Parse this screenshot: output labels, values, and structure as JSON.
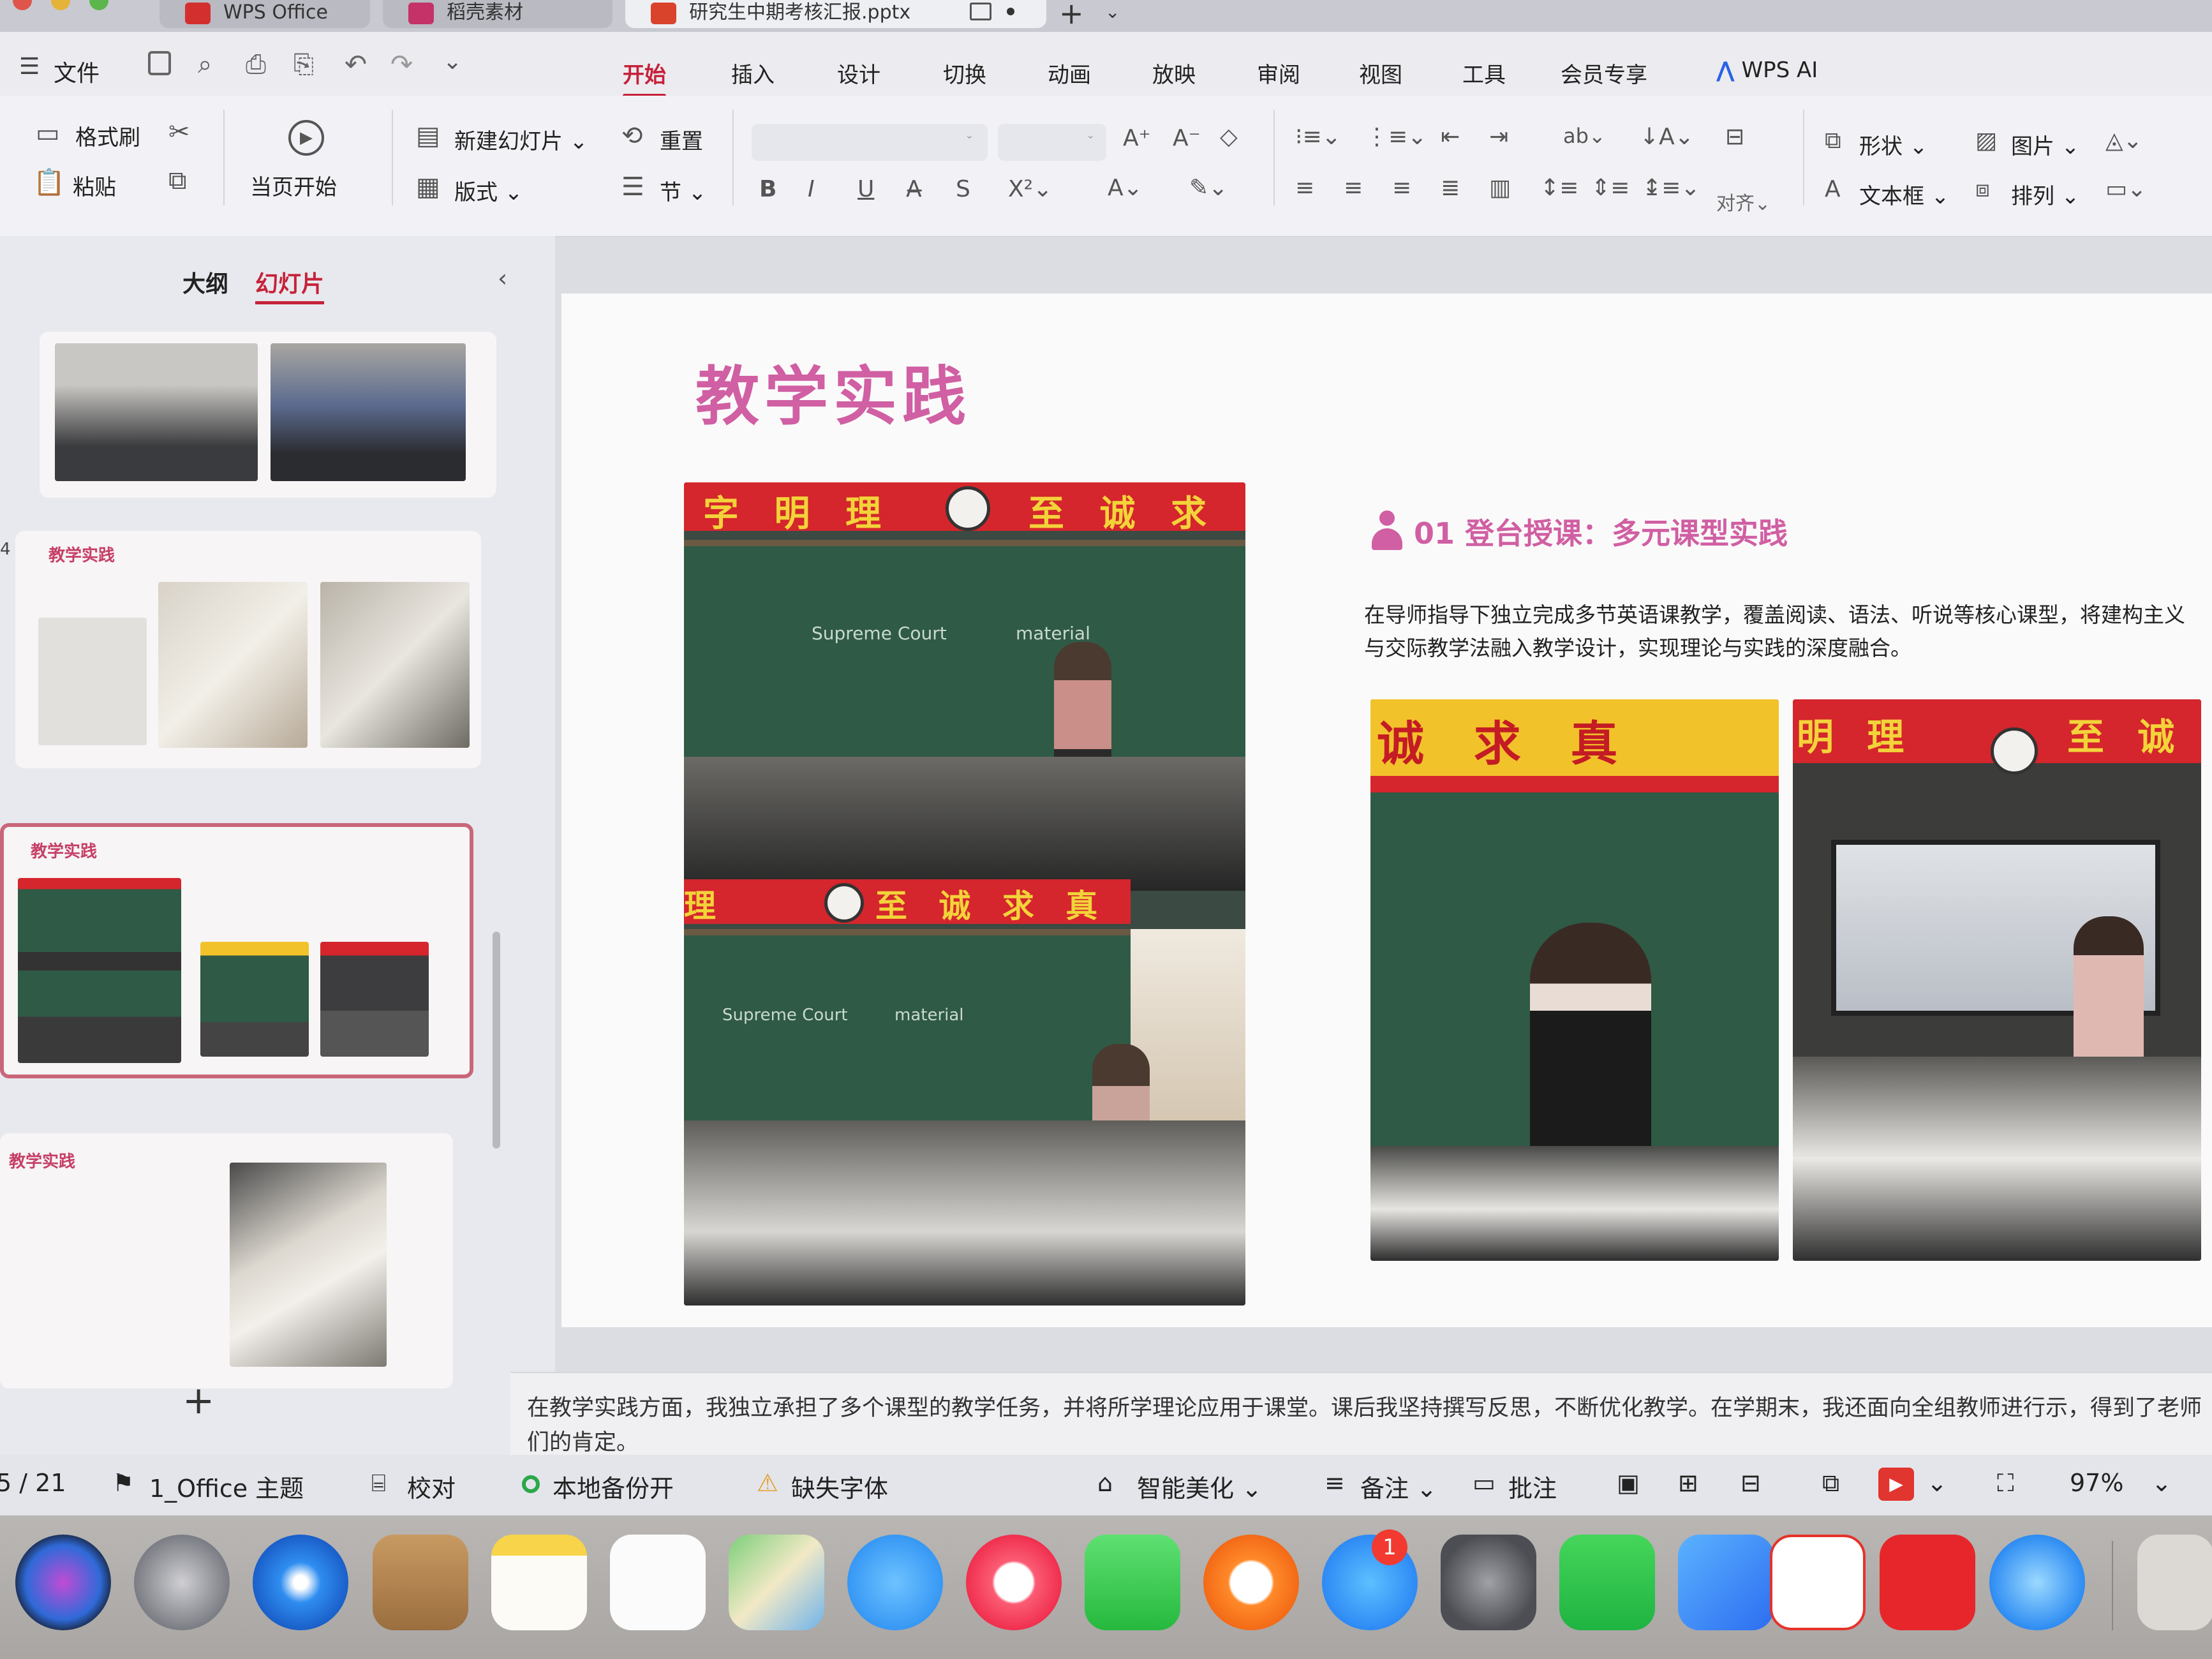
{
  "tabs": [
    {
      "label": "WPS Office",
      "active": false
    },
    {
      "label": "稻壳素材",
      "active": false
    },
    {
      "label": "研究生中期考核汇报.pptx",
      "active": true
    }
  ],
  "menu": {
    "file": "文件",
    "tabs": [
      "开始",
      "插入",
      "设计",
      "切换",
      "动画",
      "放映",
      "审阅",
      "视图",
      "工具",
      "会员专享"
    ],
    "active": "开始",
    "ai": "WPS AI"
  },
  "ribbon": {
    "format_painter": "格式刷",
    "paste": "粘贴",
    "play_current": "当页开始",
    "new_slide": "新建幻灯片",
    "layout": "版式",
    "reset": "重置",
    "section": "节",
    "align": "对齐",
    "shape": "形状",
    "picture": "图片",
    "textbox": "文本框",
    "arrange": "排列"
  },
  "panel": {
    "outline_tab": "大纲",
    "slides_tab": "幻灯片",
    "thumb_titles": [
      "教学实践",
      "教学实践",
      "教学实践"
    ],
    "thumb_slide_number": "4",
    "add": "+"
  },
  "slide": {
    "title": "教学实践",
    "subtitle": "01 登台授课：多元课型实践",
    "body": "在导师指导下独立完成多节英语课教学，覆盖阅读、语法、听说等核心课型，将建构主义与交际教学法融入教学设计，实现理论与实践的深度融合。",
    "photo_banners": [
      "字 明 理",
      "至 诚 求",
      "理",
      "至 诚 求 真",
      "诚 求 真",
      "明 理",
      "至 诚"
    ],
    "board_texts": [
      "Supreme Court",
      "material",
      "Supreme Court",
      "material"
    ]
  },
  "notes": "在教学实践方面，我独立承担了多个课型的教学任务，并将所学理论应用于课堂。课后我坚持撰写反思，不断优化教学。在学期末，我还面向全组教师进行示，得到了老师们的肯定。",
  "status": {
    "page": "5 / 21",
    "theme": "1_Office 主题",
    "proof": "校对",
    "backup": "本地备份开",
    "missing_font": "缺失字体",
    "beautify": "智能美化",
    "notes": "备注",
    "comments": "批注",
    "zoom": "97%"
  },
  "dock": {
    "appstore_badge": "1"
  },
  "colors": {
    "accent": "#c6223a",
    "slide_title": "#d05fa3",
    "board": "#2f5a45",
    "banner_red": "#d4262c",
    "banner_yellow": "#f2c22a"
  }
}
